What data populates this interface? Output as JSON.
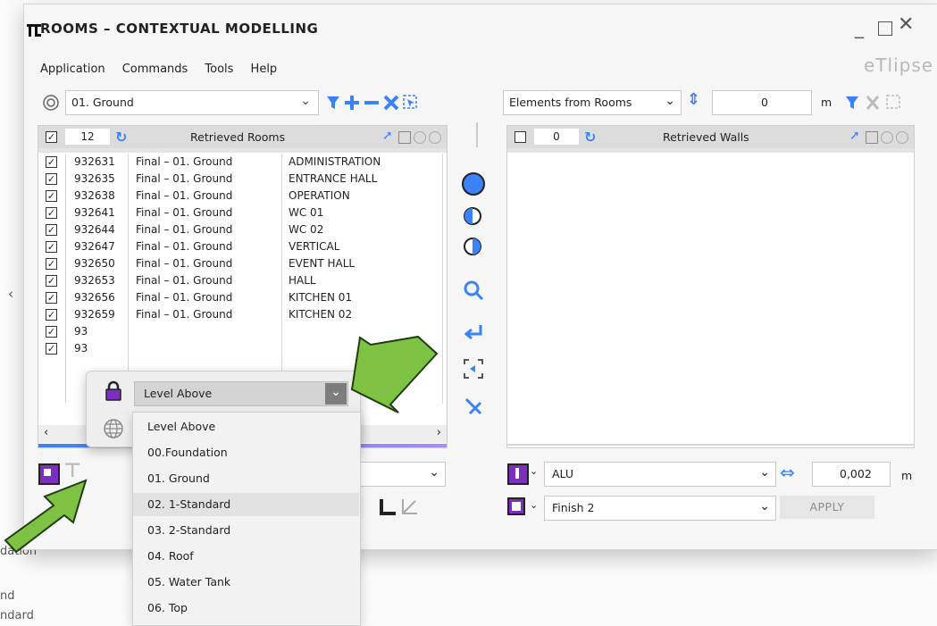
{
  "window": {
    "title": "ROOMS – CONTEXTUAL MODELLING",
    "brand": "eTlipse",
    "controls": [
      "minimize",
      "maximize",
      "close"
    ]
  },
  "menu": [
    "Application",
    "Commands",
    "Tools",
    "Help"
  ],
  "left_panel": {
    "level_select": "01. Ground",
    "count": "12",
    "header": "Retrieved Rooms",
    "rows": [
      {
        "id": "932631",
        "level": "Final – 01. Ground",
        "name": "ADMINISTRATION"
      },
      {
        "id": "932635",
        "level": "Final – 01. Ground",
        "name": "ENTRANCE HALL"
      },
      {
        "id": "932638",
        "level": "Final – 01. Ground",
        "name": "OPERATION"
      },
      {
        "id": "932641",
        "level": "Final – 01. Ground",
        "name": "WC 01"
      },
      {
        "id": "932644",
        "level": "Final – 01. Ground",
        "name": "WC 02"
      },
      {
        "id": "932647",
        "level": "Final – 01. Ground",
        "name": "VERTICAL"
      },
      {
        "id": "932650",
        "level": "Final – 01. Ground",
        "name": "EVENT HALL"
      },
      {
        "id": "932653",
        "level": "Final – 01. Ground",
        "name": "HALL"
      },
      {
        "id": "932656",
        "level": "Final – 01. Ground",
        "name": "KITCHEN 01"
      },
      {
        "id": "932659",
        "level": "Final – 01. Ground",
        "name": "KITCHEN 02"
      },
      {
        "id": "93",
        "level": "",
        "name": ""
      },
      {
        "id": "93",
        "level": "",
        "name": ""
      }
    ]
  },
  "right_panel": {
    "source_select": "Elements from Rooms",
    "offset_value": "0",
    "offset_unit": "m",
    "count": "0",
    "header": "Retrieved Walls",
    "wall_type": "ALU",
    "thickness_value": "0,002",
    "thickness_unit": "m",
    "finish_select": "Finish 2",
    "apply_label": "APPLY"
  },
  "popup": {
    "selected": "Level Above",
    "options": [
      "Level Above",
      "00.Foundation",
      "01. Ground",
      "02. 1-Standard",
      "03. 2-Standard",
      "04. Roof",
      "05. Water Tank",
      "06. Top"
    ]
  },
  "background_text": [
    "dation",
    "nd",
    "ndard"
  ],
  "colors": {
    "accent_blue": "#3b82f6",
    "purple": "#7b2fbe",
    "arrow_green": "#7dc242"
  }
}
